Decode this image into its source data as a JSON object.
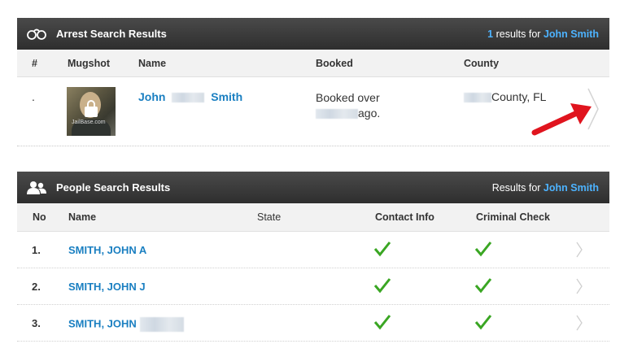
{
  "arrest": {
    "title": "Arrest Search Results",
    "result_count": "1",
    "results_for_text": " results for ",
    "query": "John Smith",
    "columns": [
      "#",
      "Mugshot",
      "Name",
      "Booked",
      "County"
    ],
    "rows": [
      {
        "index": ".",
        "name_first": "John",
        "name_last": "Smith",
        "booked_line1": "Booked over",
        "booked_line2": "ago.",
        "county": "County, FL",
        "mugshot_watermark": "JailBase.com"
      }
    ]
  },
  "people": {
    "title": "People Search Results",
    "results_for_text": "Results for ",
    "query_first": "John",
    "query_last": "Smith",
    "columns": [
      "No",
      "Name",
      "State",
      "Contact Info",
      "Criminal Check"
    ],
    "rows": [
      {
        "no": "1.",
        "name": "SMITH, JOHN A"
      },
      {
        "no": "2.",
        "name": "SMITH, JOHN J"
      },
      {
        "no": "3.",
        "name": "SMITH, JOHN"
      }
    ]
  },
  "colors": {
    "header_bg": "#333333",
    "link_blue": "#1a7fc1",
    "highlight_blue": "#4db3ff",
    "check_green": "#3aa623",
    "arrow_red": "#e0141e"
  },
  "icons": {
    "arrest_header": "handcuffs-icon",
    "people_header": "people-icon",
    "row_chevron": "chevron-right-icon",
    "check": "check-icon"
  }
}
